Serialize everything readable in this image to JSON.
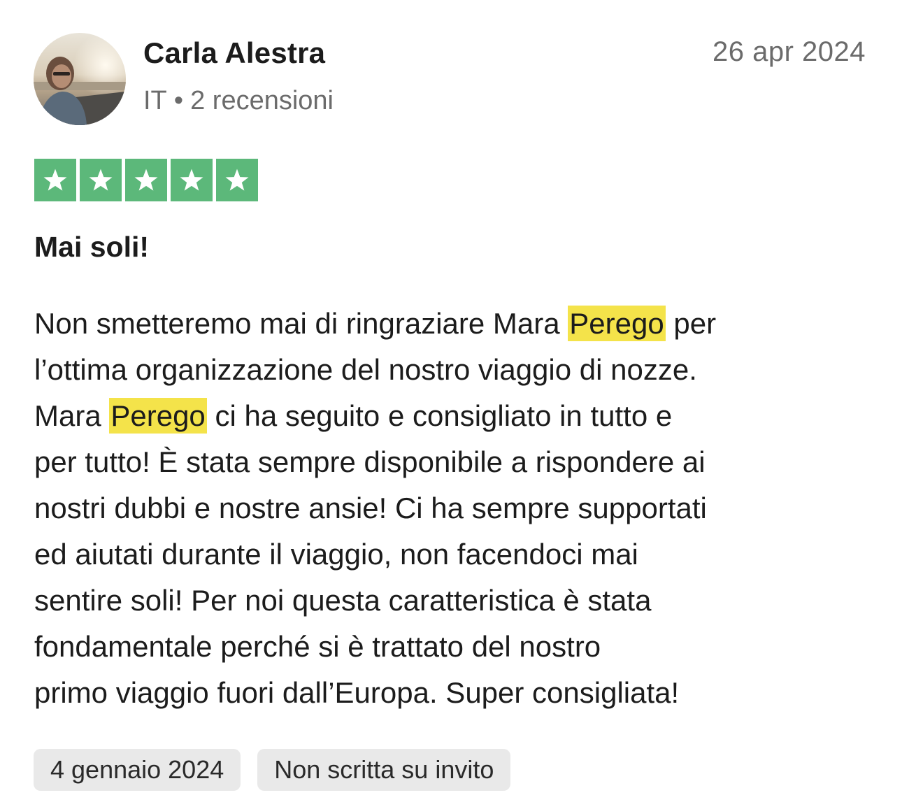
{
  "author": {
    "name": "Carla Alestra",
    "country": "IT",
    "separator": "•",
    "reviews_count": "2 recensioni"
  },
  "review": {
    "date": "26 apr 2024",
    "rating": 5,
    "rating_max": 5,
    "star_color": "#5cb87a",
    "title": "Mai soli!",
    "highlight_color": "#f4e34a",
    "body_lines": [
      [
        "Non smetteremo mai di ringraziare Mara ",
        "Perego",
        " per"
      ],
      [
        "l’ottima organizzazione del nostro viaggio di nozze."
      ],
      [
        "Mara ",
        "Perego",
        " ci ha seguito e consigliato in tutto e"
      ],
      [
        "per tutto! È stata sempre disponibile a rispondere ai"
      ],
      [
        "nostri dubbi e nostre ansie! Ci ha sempre supportati"
      ],
      [
        "ed aiutati durante il viaggio, non facendoci mai"
      ],
      [
        "sentire soli! Per noi questa caratteristica è stata"
      ],
      [
        "fondamentale perché si è trattato del nostro"
      ],
      [
        "primo viaggio fuori dall’Europa. Super consigliata!"
      ]
    ]
  },
  "tags": {
    "experience_date": "4 gennaio 2024",
    "invite_status": "Non scritta su invito"
  },
  "icons": {
    "star": "star-icon",
    "avatar": "user-avatar"
  }
}
